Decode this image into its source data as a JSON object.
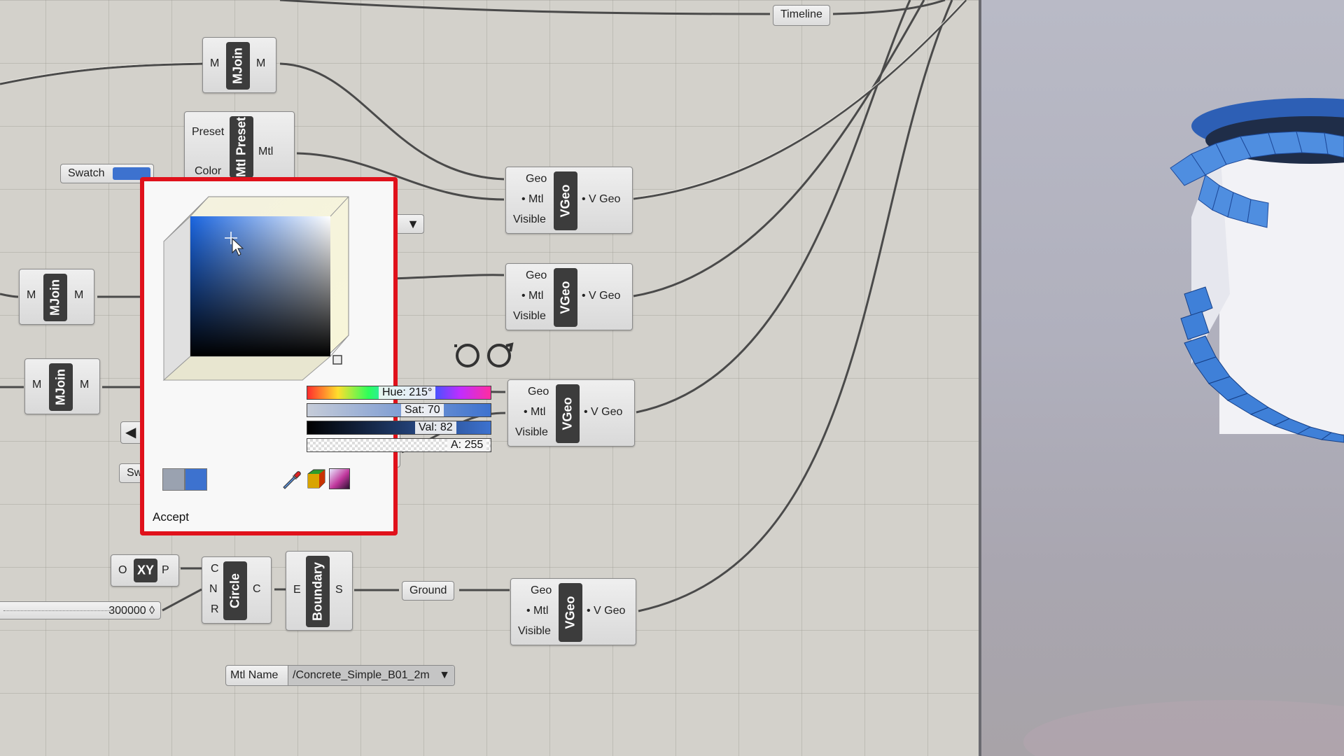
{
  "canvas": {
    "components": {
      "mjoin": {
        "name": "MJoin",
        "input": "M",
        "output": "M"
      },
      "mtl_preset": {
        "name": "Mtl Preset",
        "inputs": [
          "Preset",
          "Color"
        ],
        "output": "Mtl"
      },
      "vgeo": {
        "name": "VGeo",
        "inputs": [
          "Geo",
          "Mtl",
          "Visible"
        ],
        "output": "V Geo"
      },
      "xy": {
        "name": "XY",
        "input": "O",
        "output": "P"
      },
      "circle": {
        "name": "Circle",
        "inputs": [
          "C",
          "N",
          "R"
        ],
        "output": "C"
      },
      "boundary": {
        "name": "Boundary",
        "input": "E",
        "output": "S"
      }
    },
    "timeline_label": "Timeline",
    "swatch_label": "Swatch",
    "swatch_partial_label": "Sw",
    "ground_label": "Ground",
    "slider_value": "300000 ◊",
    "mtl_name": {
      "label": "Mtl Name",
      "value": "/Concrete_Simple_B01_2m"
    },
    "glasses_icon": "view-glasses-icon"
  },
  "color_picker": {
    "hue_label": "Hue: 215°",
    "sat_label": "Sat: 70",
    "val_label": "Val: 82",
    "alpha_label": "A: 255",
    "accept_label": "Accept",
    "hue": 215,
    "sat": 70,
    "val": 82,
    "alpha": 255,
    "current_color": "#3d72cf",
    "previous_color": "#9aa2b0",
    "tools": [
      "eyedropper-icon",
      "color-cube-icon",
      "gradient-swatch-icon"
    ]
  },
  "colors": {
    "highlight_border": "#e0111b",
    "canvas_bg": "#d3d1cb",
    "swatch_blue": "#3d72cf"
  }
}
